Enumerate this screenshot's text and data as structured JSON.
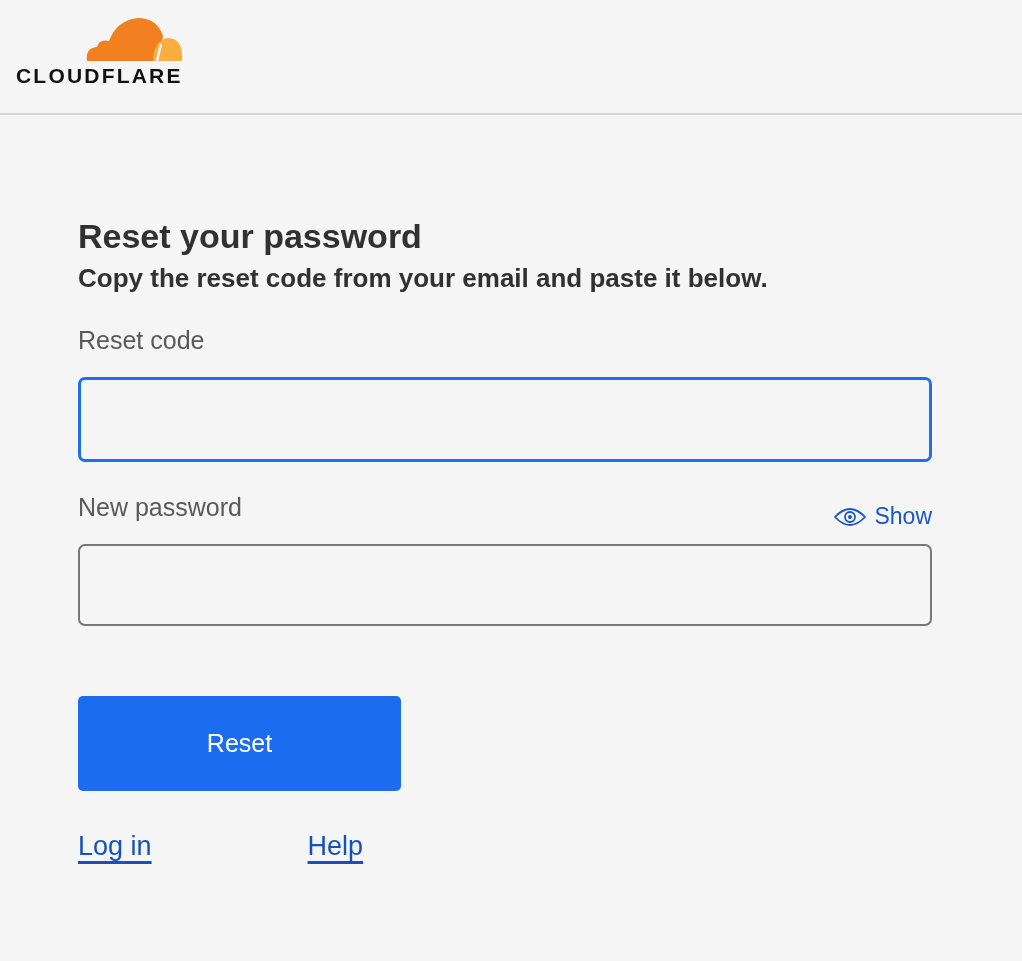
{
  "header": {
    "logo_text": "CLOUDFLARE"
  },
  "form": {
    "title": "Reset your password",
    "subtitle": "Copy the reset code from your email and paste it below.",
    "fields": [
      {
        "label": "Reset code",
        "focused": true
      },
      {
        "label": "New password",
        "focused": false,
        "toggle": "Show"
      }
    ],
    "button": "Reset",
    "links": [
      "Log in",
      "Help"
    ]
  }
}
